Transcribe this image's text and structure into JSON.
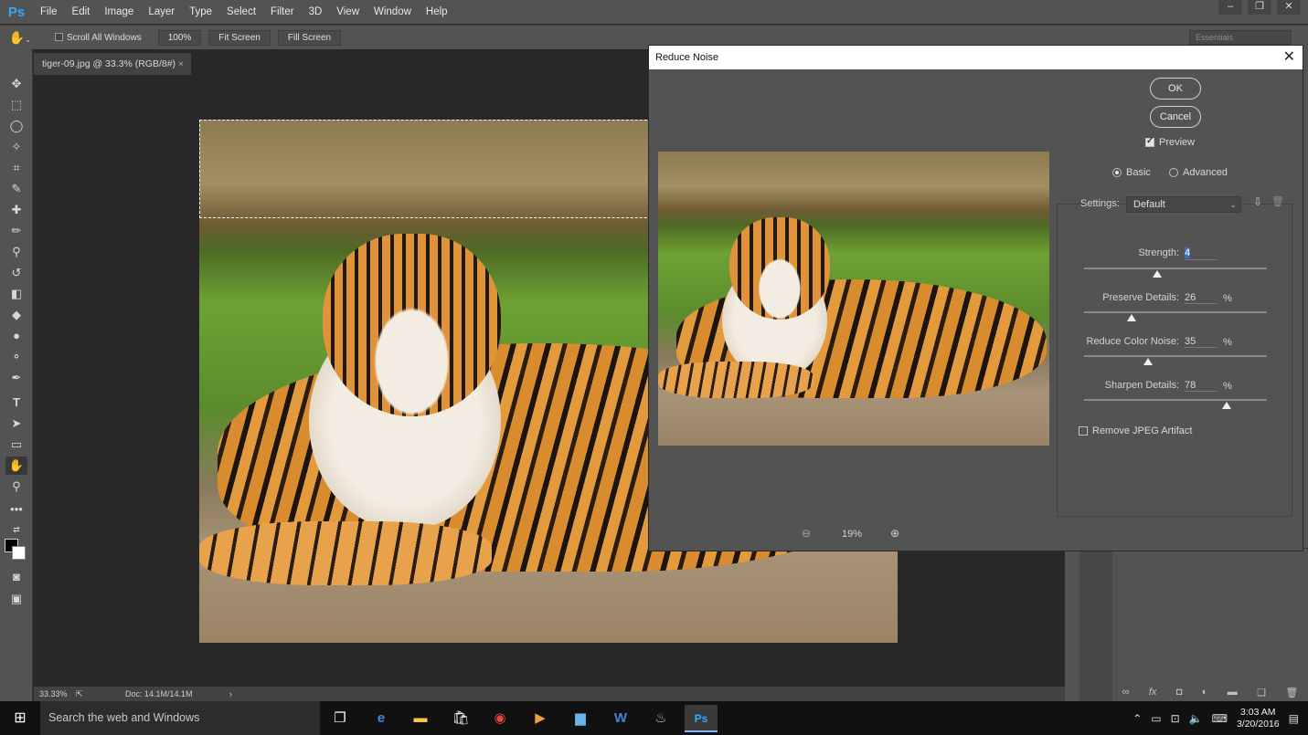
{
  "app": {
    "logo": "Ps"
  },
  "menu": {
    "items": [
      "File",
      "Edit",
      "Image",
      "Layer",
      "Type",
      "Select",
      "Filter",
      "3D",
      "View",
      "Window",
      "Help"
    ]
  },
  "options_bar": {
    "scroll_all_windows": "Scroll All Windows",
    "zoom_100": "100%",
    "fit_screen": "Fit Screen",
    "fill_screen": "Fill Screen",
    "workspace": "Essentials"
  },
  "document": {
    "tab_title": "tiger-09.jpg @ 33.3% (RGB/8#)",
    "tab_close": "×",
    "zoom": "33.33%",
    "doc_size": "Doc: 14.1M/14.1M"
  },
  "dialog": {
    "title": "Reduce Noise",
    "ok_label": "OK",
    "cancel_label": "Cancel",
    "preview_label": "Preview",
    "preview_checked": true,
    "mode_basic": "Basic",
    "mode_advanced": "Advanced",
    "mode_selected": "Basic",
    "settings_label": "Settings:",
    "settings_value": "Default",
    "strength_label": "Strength:",
    "strength_value": "4",
    "preserve_label": "Preserve Details:",
    "preserve_value": "26",
    "color_noise_label": "Reduce Color Noise:",
    "color_noise_value": "35",
    "sharpen_label": "Sharpen Details:",
    "sharpen_value": "78",
    "percent": "%",
    "jpeg_label": "Remove JPEG Artifact",
    "jpeg_checked": false,
    "preview_zoom": "19%"
  },
  "sliders": {
    "strength": 0.4,
    "preserve": 0.26,
    "color_noise": 0.35,
    "sharpen": 0.78
  },
  "taskbar": {
    "search_placeholder": "Search the web and Windows",
    "time": "3:03 AM",
    "date": "3/20/2016"
  },
  "icons": {
    "tools": [
      "move-icon",
      "marquee-icon",
      "lasso-icon",
      "magic-wand-icon",
      "crop-icon",
      "eyedropper-icon",
      "healing-brush-icon",
      "brush-icon",
      "clone-stamp-icon",
      "history-brush-icon",
      "eraser-icon",
      "paint-bucket-icon",
      "blur-icon",
      "dodge-icon",
      "pen-icon",
      "type-icon",
      "path-selection-icon",
      "rectangle-shape-icon",
      "hand-icon",
      "zoom-icon",
      "more-tools-icon"
    ]
  },
  "colors": {
    "accent": "#31a8ff",
    "panel": "#535353",
    "canvas": "#282828"
  }
}
